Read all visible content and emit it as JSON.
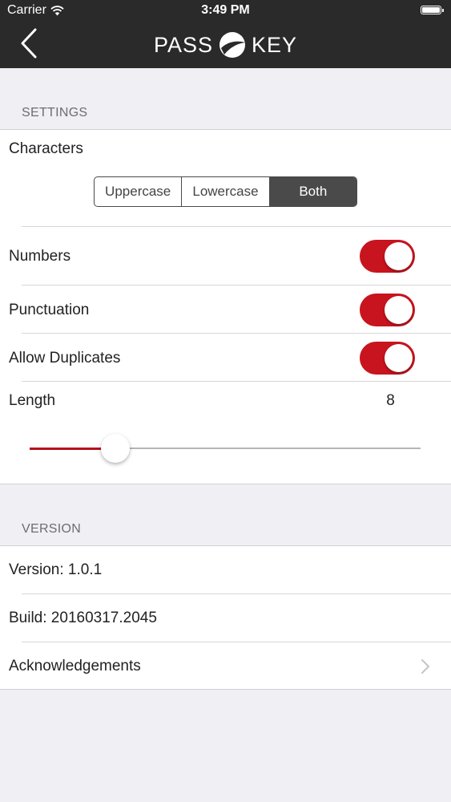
{
  "status_bar": {
    "carrier": "Carrier",
    "time": "3:49 PM",
    "wifi_icon": "wifi-icon",
    "battery_icon": "battery-icon"
  },
  "nav": {
    "back_icon": "chevron-left-icon",
    "logo_left": "PASS",
    "logo_right": "KEY",
    "logo_icon": "key-logo-icon"
  },
  "settings": {
    "header": "SETTINGS",
    "characters": {
      "label": "Characters",
      "options": [
        "Uppercase",
        "Lowercase",
        "Both"
      ],
      "selected": "Both"
    },
    "numbers": {
      "label": "Numbers",
      "on": true
    },
    "punctuation": {
      "label": "Punctuation",
      "on": true
    },
    "allow_duplicates": {
      "label": "Allow Duplicates",
      "on": true
    },
    "length": {
      "label": "Length",
      "value": "8",
      "slider_fraction": 0.22
    }
  },
  "version_section": {
    "header": "VERSION",
    "version": "Version: 1.0.1",
    "build": "Build: 20160317.2045",
    "acknowledgements": "Acknowledgements",
    "chevron_icon": "chevron-right-icon"
  },
  "colors": {
    "accent": "#c8141e",
    "nav_bg": "#2a2a2a",
    "page_bg": "#efeff4"
  }
}
